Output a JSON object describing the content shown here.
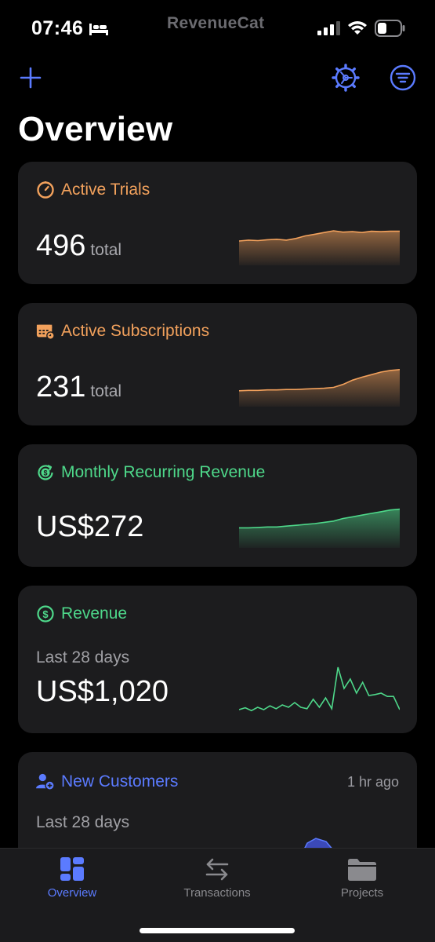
{
  "status_bar": {
    "time": "07:46",
    "carrier_logo": "RevenueCat"
  },
  "toolbar": {
    "add_icon": "plus-icon",
    "settings_icon": "gear-icon",
    "filter_icon": "filter-icon"
  },
  "page": {
    "title": "Overview"
  },
  "cards": {
    "active_trials": {
      "title": "Active Trials",
      "value": "496",
      "unit": "total",
      "color": "#f2a15c",
      "trend": [
        0.5,
        0.52,
        0.51,
        0.53,
        0.54,
        0.52,
        0.56,
        0.62,
        0.66,
        0.7,
        0.74,
        0.71,
        0.72,
        0.7,
        0.73,
        0.72,
        0.73,
        0.73
      ]
    },
    "active_subscriptions": {
      "title": "Active Subscriptions",
      "value": "231",
      "unit": "total",
      "color": "#f2a15c",
      "trend": [
        0.3,
        0.31,
        0.31,
        0.32,
        0.32,
        0.33,
        0.33,
        0.34,
        0.35,
        0.36,
        0.38,
        0.45,
        0.55,
        0.62,
        0.68,
        0.74,
        0.78,
        0.8
      ]
    },
    "mrr": {
      "title": "Monthly Recurring Revenue",
      "value": "US$272",
      "color": "#4ed88a",
      "trend": [
        0.4,
        0.4,
        0.41,
        0.42,
        0.42,
        0.44,
        0.46,
        0.48,
        0.5,
        0.53,
        0.56,
        0.62,
        0.66,
        0.7,
        0.74,
        0.78,
        0.82,
        0.84
      ]
    },
    "revenue": {
      "title": "Revenue",
      "period": "Last 28 days",
      "value": "US$1,020",
      "color": "#4ed88a",
      "trend": [
        0.1,
        0.14,
        0.08,
        0.15,
        0.1,
        0.18,
        0.12,
        0.2,
        0.15,
        0.25,
        0.15,
        0.12,
        0.32,
        0.15,
        0.35,
        0.12,
        1.0,
        0.55,
        0.75,
        0.45,
        0.68,
        0.4,
        0.42,
        0.45,
        0.38,
        0.38,
        0.1
      ]
    },
    "new_customers": {
      "title": "New Customers",
      "meta": "1 hr ago",
      "period": "Last 28 days",
      "color": "#5b7bff"
    }
  },
  "tab_bar": {
    "tabs": [
      {
        "label": "Overview",
        "icon": "dashboard-icon",
        "active": true
      },
      {
        "label": "Transactions",
        "icon": "arrows-swap-icon",
        "active": false
      },
      {
        "label": "Projects",
        "icon": "folder-icon",
        "active": false
      }
    ]
  }
}
